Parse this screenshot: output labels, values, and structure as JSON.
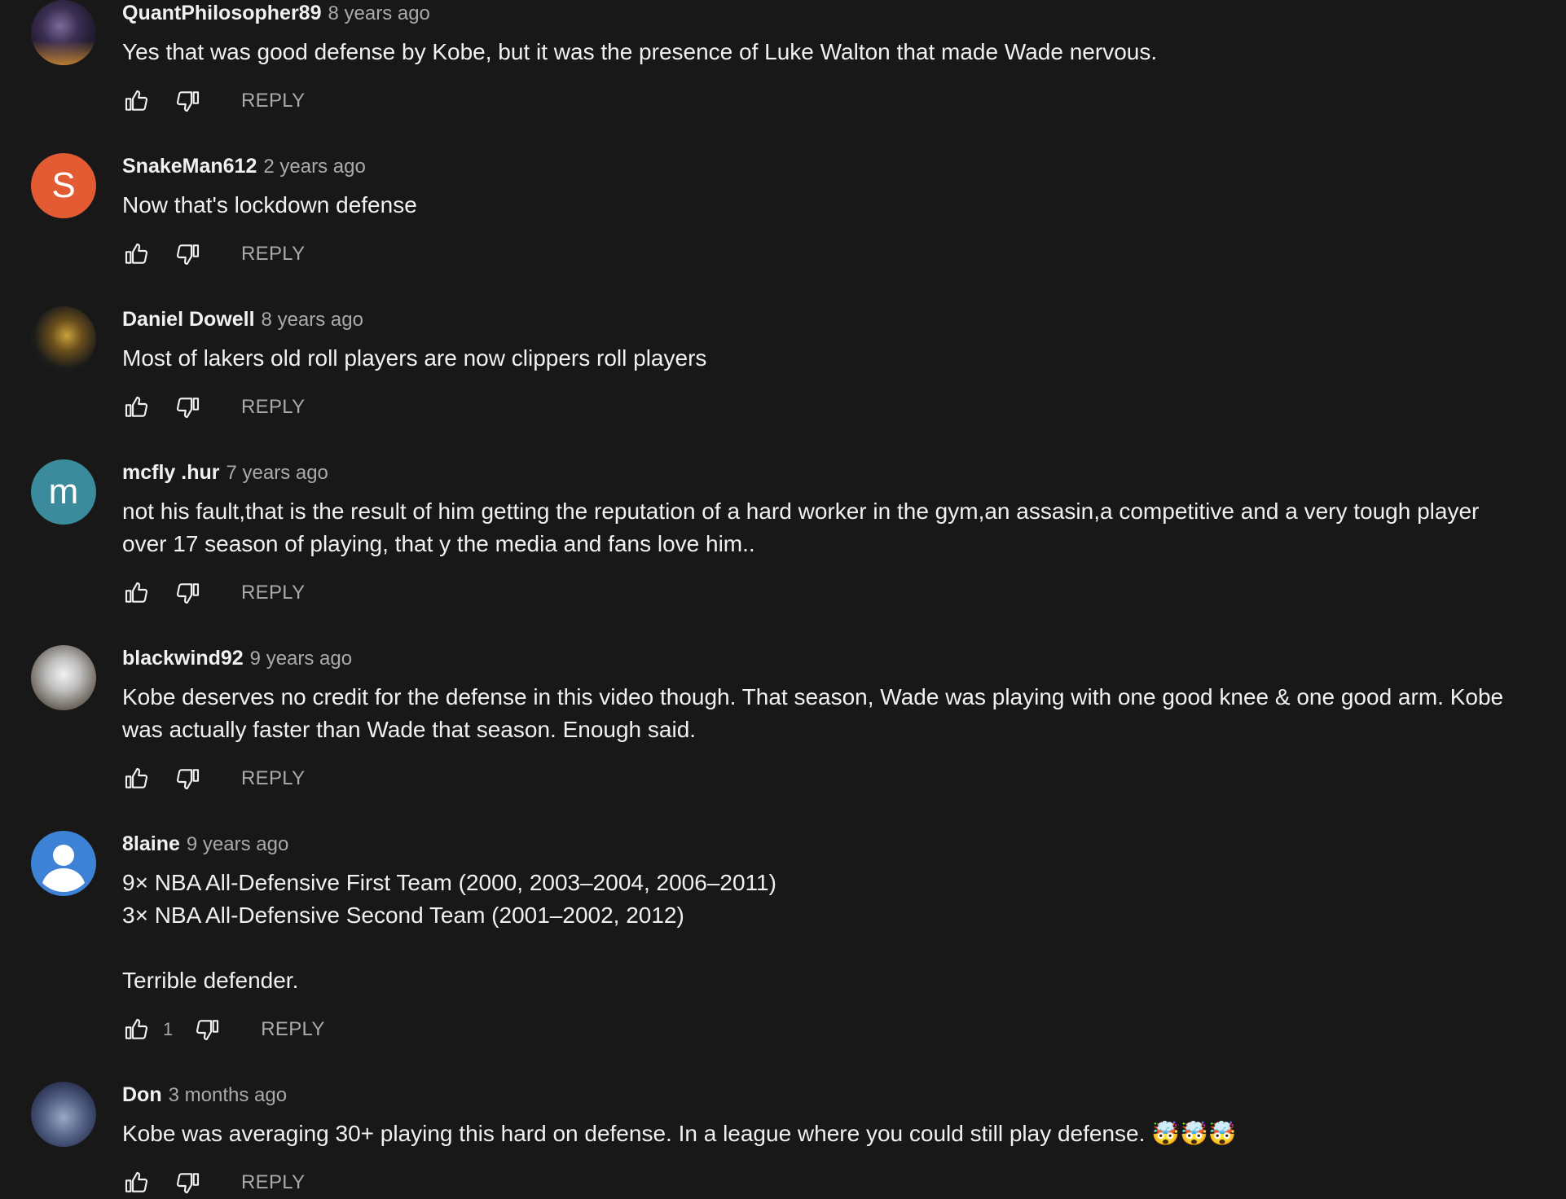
{
  "comments": [
    {
      "author": "QuantPhilosopher89",
      "time": "8 years ago",
      "text": "Yes that was good defense by Kobe, but it was the presence of Luke Walton that made Wade nervous.",
      "avatar": {
        "type": "image",
        "icon": "profile-photo-city-night"
      },
      "likes": "",
      "reply_label": "REPLY"
    },
    {
      "author": "SnakeMan612",
      "time": "2 years ago",
      "text": "Now that's lockdown defense",
      "avatar": {
        "type": "letter",
        "letter": "S",
        "color": "#e35b32"
      },
      "likes": "",
      "reply_label": "REPLY"
    },
    {
      "author": "Daniel Dowell",
      "time": "8 years ago",
      "text": "Most of lakers old roll players are now clippers roll players",
      "avatar": {
        "type": "image",
        "icon": "profile-photo-lakers-player"
      },
      "likes": "",
      "reply_label": "REPLY"
    },
    {
      "author": "mcfly .hur",
      "time": "7 years ago",
      "text": "not his fault,that is the result of him getting the reputation of a hard worker in the gym,an assasin,a competitive and a very tough player over 17 season of playing, that y the media and fans love him..",
      "avatar": {
        "type": "letter",
        "letter": "m",
        "color": "#3b8b9c"
      },
      "likes": "",
      "reply_label": "REPLY"
    },
    {
      "author": "blackwind92",
      "time": "9 years ago",
      "text": "Kobe deserves no credit for the defense in this video though. That season, Wade was playing with one good knee & one good arm. Kobe was actually faster than Wade that season. Enough said.",
      "avatar": {
        "type": "image",
        "icon": "profile-photo-two-men"
      },
      "likes": "",
      "reply_label": "REPLY"
    },
    {
      "author": "8laine",
      "time": "9 years ago",
      "text": "9× NBA All-Defensive First Team (2000, 2003–2004, 2006–2011)\n3× NBA All-Defensive Second Team (2001–2002, 2012)\n\nTerrible defender.",
      "avatar": {
        "type": "default",
        "icon": "default-user-icon",
        "color": "#3e82d6"
      },
      "likes": "1",
      "reply_label": "REPLY"
    },
    {
      "author": "Don",
      "time": "3 months ago",
      "text": "Kobe was averaging 30+ playing this hard on defense. In a league where you could still play defense. 🤯🤯🤯",
      "avatar": {
        "type": "image",
        "icon": "profile-photo-cartoon"
      },
      "likes": "",
      "reply_label": "REPLY"
    }
  ],
  "icons": {
    "like": "thumbs-up-icon",
    "dislike": "thumbs-down-icon"
  }
}
